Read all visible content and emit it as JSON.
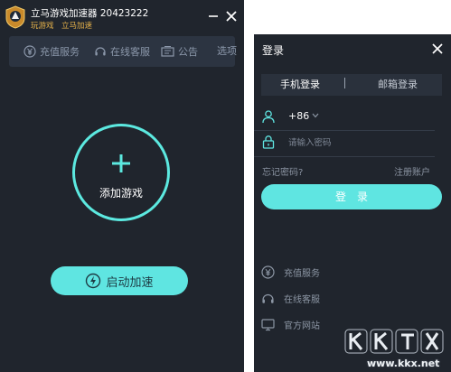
{
  "app": {
    "name_line": "立马游戏加速器 20423222",
    "sub_line": "玩游戏　立马加速"
  },
  "toolbar": {
    "recharge": "充值服务",
    "support": "在线客服",
    "notice": "公告",
    "options": "选项"
  },
  "main": {
    "add_game_label": "添加游戏",
    "accelerate_label": "启动加速"
  },
  "login": {
    "title": "登录",
    "tab_phone": "手机登录",
    "tab_email": "邮箱登录",
    "country_code": "+86",
    "password_placeholder": "请输入密码",
    "forgot_password": "忘记密码?",
    "register": "注册账户",
    "login_button": "登录"
  },
  "services": [
    {
      "label": "充值服务",
      "icon": "yen-circle-icon"
    },
    {
      "label": "在线客服",
      "icon": "headset-icon"
    },
    {
      "label": "官方网站",
      "icon": "monitor-icon"
    }
  ],
  "watermark": {
    "text": "www.kkx.net"
  },
  "colors": {
    "background": "#20252d",
    "toolbar": "#2c3441",
    "accent": "#5fe5e1",
    "brand_gold": "#e6b24a",
    "muted_text": "#8c98ab"
  }
}
